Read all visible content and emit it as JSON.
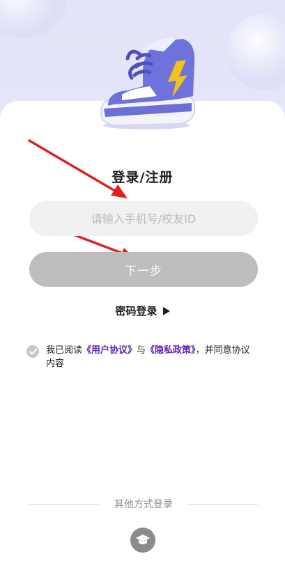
{
  "title": "登录/注册",
  "phone_input": {
    "placeholder": "请输入手机号/校友ID",
    "value": ""
  },
  "next_button": "下一步",
  "password_login": "密码登录",
  "agreement": {
    "prefix": "我已阅读",
    "user_agreement": "《用户协议》",
    "connector": "与",
    "privacy_policy": "《隐私政策》",
    "suffix": "，并同意协议内容",
    "checked": true
  },
  "other_login_label": "其他方式登录",
  "icons": {
    "shoe": "sneaker-illustration",
    "check": "check-icon",
    "graduation": "graduation-cap-icon",
    "play": "play-triangle-icon"
  },
  "colors": {
    "link": "#5b21b6",
    "button_disabled": "#bdbdbd",
    "input_bg": "#f1f1f1",
    "arrow": "#e02020"
  }
}
